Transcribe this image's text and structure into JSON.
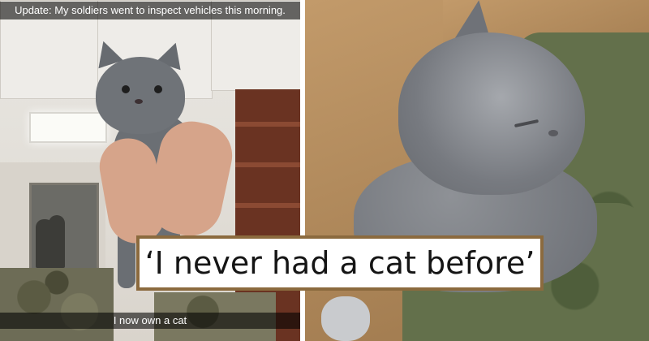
{
  "left_panel": {
    "caption_top": "Update: My soldiers went to inspect vehicles this morning.",
    "caption_bottom": "I now own a cat"
  },
  "right_panel": {
    "subject": "sleeping gray kitten"
  },
  "headline": {
    "text": "‘I never had a cat before’"
  },
  "colors": {
    "banner_border": "#8b6a3e",
    "caption_bg": "#000000"
  }
}
